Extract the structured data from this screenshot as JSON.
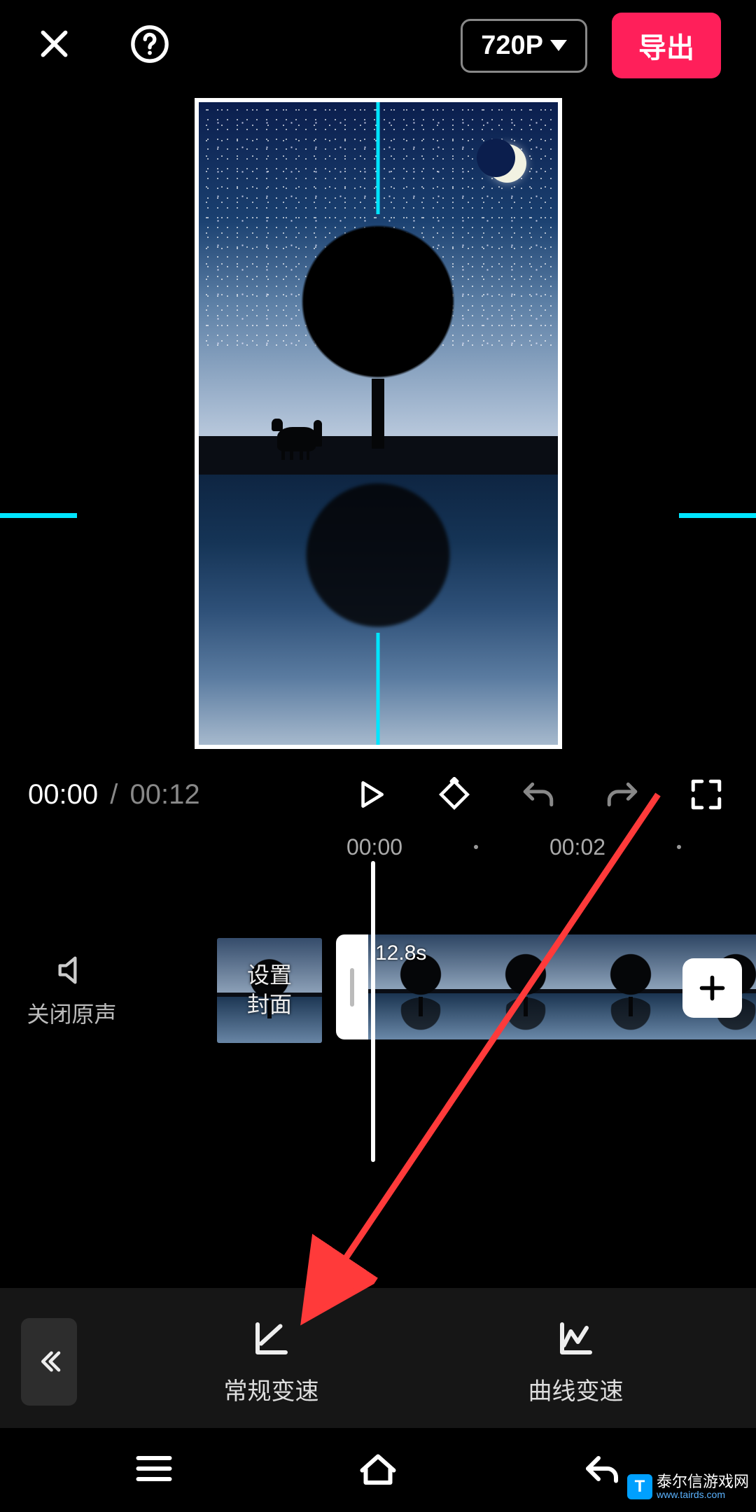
{
  "header": {
    "resolution_label": "720P",
    "export_label": "导出"
  },
  "playback": {
    "current_time": "00:00",
    "total_time": "00:12"
  },
  "ruler": {
    "marks": [
      "00:00",
      "00:02"
    ]
  },
  "timeline": {
    "mute_label": "关闭原声",
    "cover_label": "设置\n封面",
    "clip_duration": "12.8s"
  },
  "toolbar": {
    "items": [
      {
        "id": "normal-speed",
        "label": "常规变速"
      },
      {
        "id": "curve-speed",
        "label": "曲线变速"
      }
    ]
  },
  "watermark": {
    "brand": "泰尔信游戏网",
    "url": "www.tairds.com"
  }
}
